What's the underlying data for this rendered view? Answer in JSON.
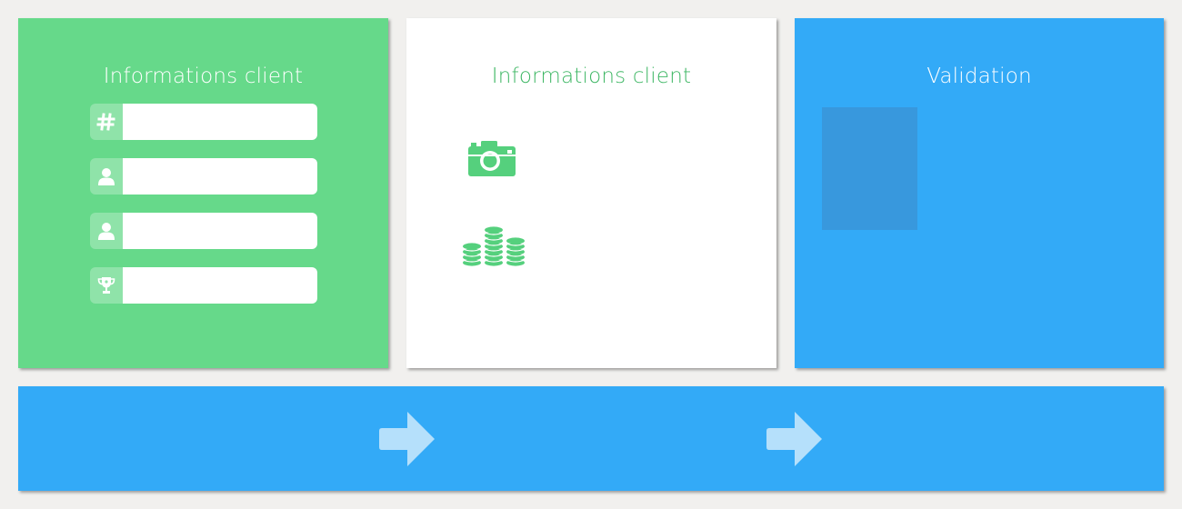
{
  "panels": {
    "client_info": {
      "title": "Informations client",
      "fields": [
        {
          "icon": "hash-icon",
          "value": ""
        },
        {
          "icon": "user-icon",
          "value": ""
        },
        {
          "icon": "user-icon",
          "value": ""
        },
        {
          "icon": "trophy-icon",
          "value": ""
        }
      ]
    },
    "media": {
      "title": "Informations client",
      "icons": [
        "camera-icon",
        "coins-icon"
      ]
    },
    "validation": {
      "title": "Validation"
    }
  },
  "navigation": {
    "arrows": [
      "arrow-right-icon",
      "arrow-right-icon"
    ]
  },
  "colors": {
    "green": "#66d98a",
    "green_text": "#3fb765",
    "blue": "#33aaf7",
    "blue_dark": "#3898dd",
    "icon_cell": "#8fe3a9",
    "arrow": "#b5e0fb",
    "background": "#f1f0ee"
  }
}
